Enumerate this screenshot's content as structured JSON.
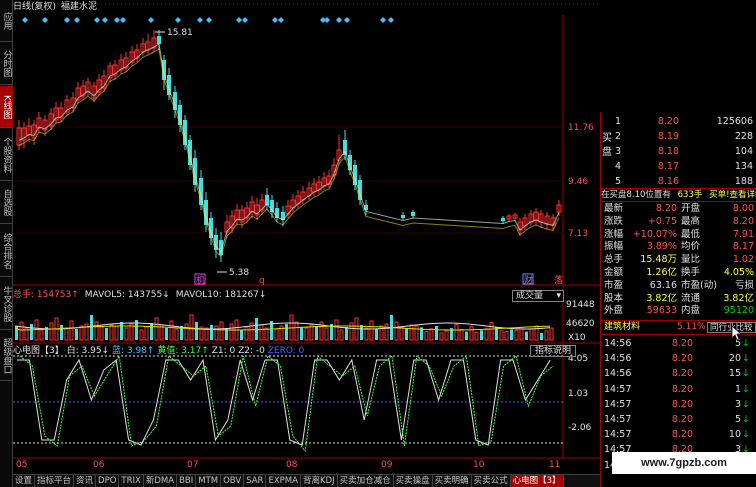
{
  "title": {
    "chart_name": "日线(复权)",
    "stock_name": "福建水泥"
  },
  "left_tabs": [
    {
      "label": "应用",
      "active": false
    },
    {
      "label": "分时图",
      "active": false
    },
    {
      "label": "K线图",
      "active": true
    },
    {
      "label": "个股资料",
      "active": false
    },
    {
      "label": "自选股",
      "active": false
    },
    {
      "label": "综合排名",
      "active": false
    },
    {
      "label": "牛叉诊股",
      "active": false
    },
    {
      "label": "超级盘口",
      "active": false
    }
  ],
  "price_labels": {
    "high_marker": "15.81",
    "low_marker": "5.38",
    "axis": [
      "11.76",
      "9.46",
      "7.13"
    ]
  },
  "event_markers": [
    {
      "label": "机",
      "color": "#e040e0"
    },
    {
      "label": "q",
      "color": "#ff4040"
    },
    {
      "label": "财",
      "color": "#8080ff"
    },
    {
      "label": "落",
      "color": "#ff4040"
    }
  ],
  "volume_header": {
    "total": "总手: 154753↑",
    "mavol5": "MAVOL5: 143755↓",
    "mavol10": "MAVOL10: 181267↓",
    "selector": "成交量",
    "axis": [
      "91448",
      "46620"
    ],
    "unit": "X10"
  },
  "indicator_header": {
    "name": "心电图【3】",
    "white": "白: 3.95↓",
    "blue": "蓝: 3.98↑",
    "yellow": "黄值: 3.17↑",
    "z1": "Z1: 0",
    "z2": "Z2: -0",
    "zero": "ZERO: 0",
    "button": "指标说明",
    "axis": [
      "4.05",
      "1.03",
      "-2.06"
    ]
  },
  "date_labels": [
    "05",
    "06",
    "07",
    "08",
    "09",
    "10",
    "11"
  ],
  "bottom_tabs": [
    {
      "label": "设置",
      "active": false
    },
    {
      "label": "指标平台",
      "active": false
    },
    {
      "label": "资讯",
      "active": false
    },
    {
      "label": "DPO",
      "active": false
    },
    {
      "label": "TRIX",
      "active": false
    },
    {
      "label": "新DMA",
      "active": false
    },
    {
      "label": "BBI",
      "active": false
    },
    {
      "label": "MTM",
      "active": false
    },
    {
      "label": "OBV",
      "active": false
    },
    {
      "label": "SAR",
      "active": false
    },
    {
      "label": "EXPMA",
      "active": false
    },
    {
      "label": "背离KDJ",
      "active": false
    },
    {
      "label": "买卖加仓减仓",
      "active": false
    },
    {
      "label": "买卖操盘",
      "active": false
    },
    {
      "label": "买卖明确",
      "active": false
    },
    {
      "label": "买卖公式",
      "active": false
    },
    {
      "label": "心电图【3】",
      "active": true
    }
  ],
  "order_book": {
    "side_label": "买盘",
    "rows": [
      {
        "level": "1",
        "price": "8.20",
        "volume": "125606"
      },
      {
        "level": "2",
        "price": "8.19",
        "volume": "228"
      },
      {
        "level": "3",
        "price": "8.18",
        "volume": "104"
      },
      {
        "level": "4",
        "price": "8.17",
        "volume": "134"
      },
      {
        "level": "5",
        "price": "8.16",
        "volume": "188"
      }
    ]
  },
  "position_bar": {
    "text": "在买盘8.10位置有",
    "qty": "633手",
    "link": "买单!查看详细"
  },
  "quote_rows": [
    {
      "l": "最新",
      "v": "8.20",
      "vc": "#ff5050",
      "r": "开盘",
      "w": "8.00",
      "wc": "#ff5050"
    },
    {
      "l": "涨跌",
      "v": "+0.75",
      "vc": "#ff5050",
      "r": "最高",
      "w": "8.20",
      "wc": "#ff5050"
    },
    {
      "l": "涨幅",
      "v": "+10.07%",
      "vc": "#ff5050",
      "r": "最低",
      "w": "7.91",
      "wc": "#ff5050"
    },
    {
      "l": "振幅",
      "v": "3.89%",
      "vc": "#ff5050",
      "r": "均价",
      "w": "8.17",
      "wc": "#ff5050"
    },
    {
      "l": "总手",
      "v": "15.48万",
      "vc": "#ffff40",
      "r": "量比",
      "w": "1.02",
      "wc": "#ff5050"
    },
    {
      "l": "金额",
      "v": "1.26亿",
      "vc": "#ffff40",
      "r": "换手",
      "w": "4.05%",
      "wc": "#ffff40"
    },
    {
      "l": "市盈",
      "v": "63.16",
      "vc": "#e0e0e0",
      "r": "市盈(动)",
      "w": "亏损",
      "wc": "#e0e0e0"
    },
    {
      "l": "股本",
      "v": "3.82亿",
      "vc": "#ffff40",
      "r": "流通",
      "w": "3.82亿",
      "wc": "#ffff40"
    },
    {
      "l": "外盘",
      "v": "59633",
      "vc": "#ff5050",
      "r": "内盘",
      "w": "95120",
      "wc": "#00d000"
    }
  ],
  "industry": {
    "name": "建筑材料",
    "change": "5.11%",
    "button": "同行业比较"
  },
  "trades": [
    {
      "time": "14:56",
      "price": "8.20",
      "vol": "5",
      "dir": "↓"
    },
    {
      "time": "14:56",
      "price": "8.20",
      "vol": "20",
      "dir": "↓"
    },
    {
      "time": "14:56",
      "price": "8.20",
      "vol": "15",
      "dir": "↓"
    },
    {
      "time": "14:57",
      "price": "8.20",
      "vol": "1",
      "dir": "↓"
    },
    {
      "time": "14:57",
      "price": "8.20",
      "vol": "3",
      "dir": "↓"
    },
    {
      "time": "14:57",
      "price": "8.20",
      "vol": "5",
      "dir": "↓"
    },
    {
      "time": "14:57",
      "price": "8.20",
      "vol": "10",
      "dir": "↓"
    },
    {
      "time": "14:57",
      "price": "8.20",
      "vol": "3",
      "dir": "↓"
    },
    {
      "time": "14:57",
      "price": "8.20",
      "vol": "1",
      "dir": "↓"
    }
  ],
  "watermark": "www.7gpzb.com",
  "colors": {
    "up": "#ff3030",
    "down": "#40e0e0",
    "grid": "#a00000",
    "ma_white": "#e0e0e0",
    "ma_yellow": "#e0e000"
  }
}
